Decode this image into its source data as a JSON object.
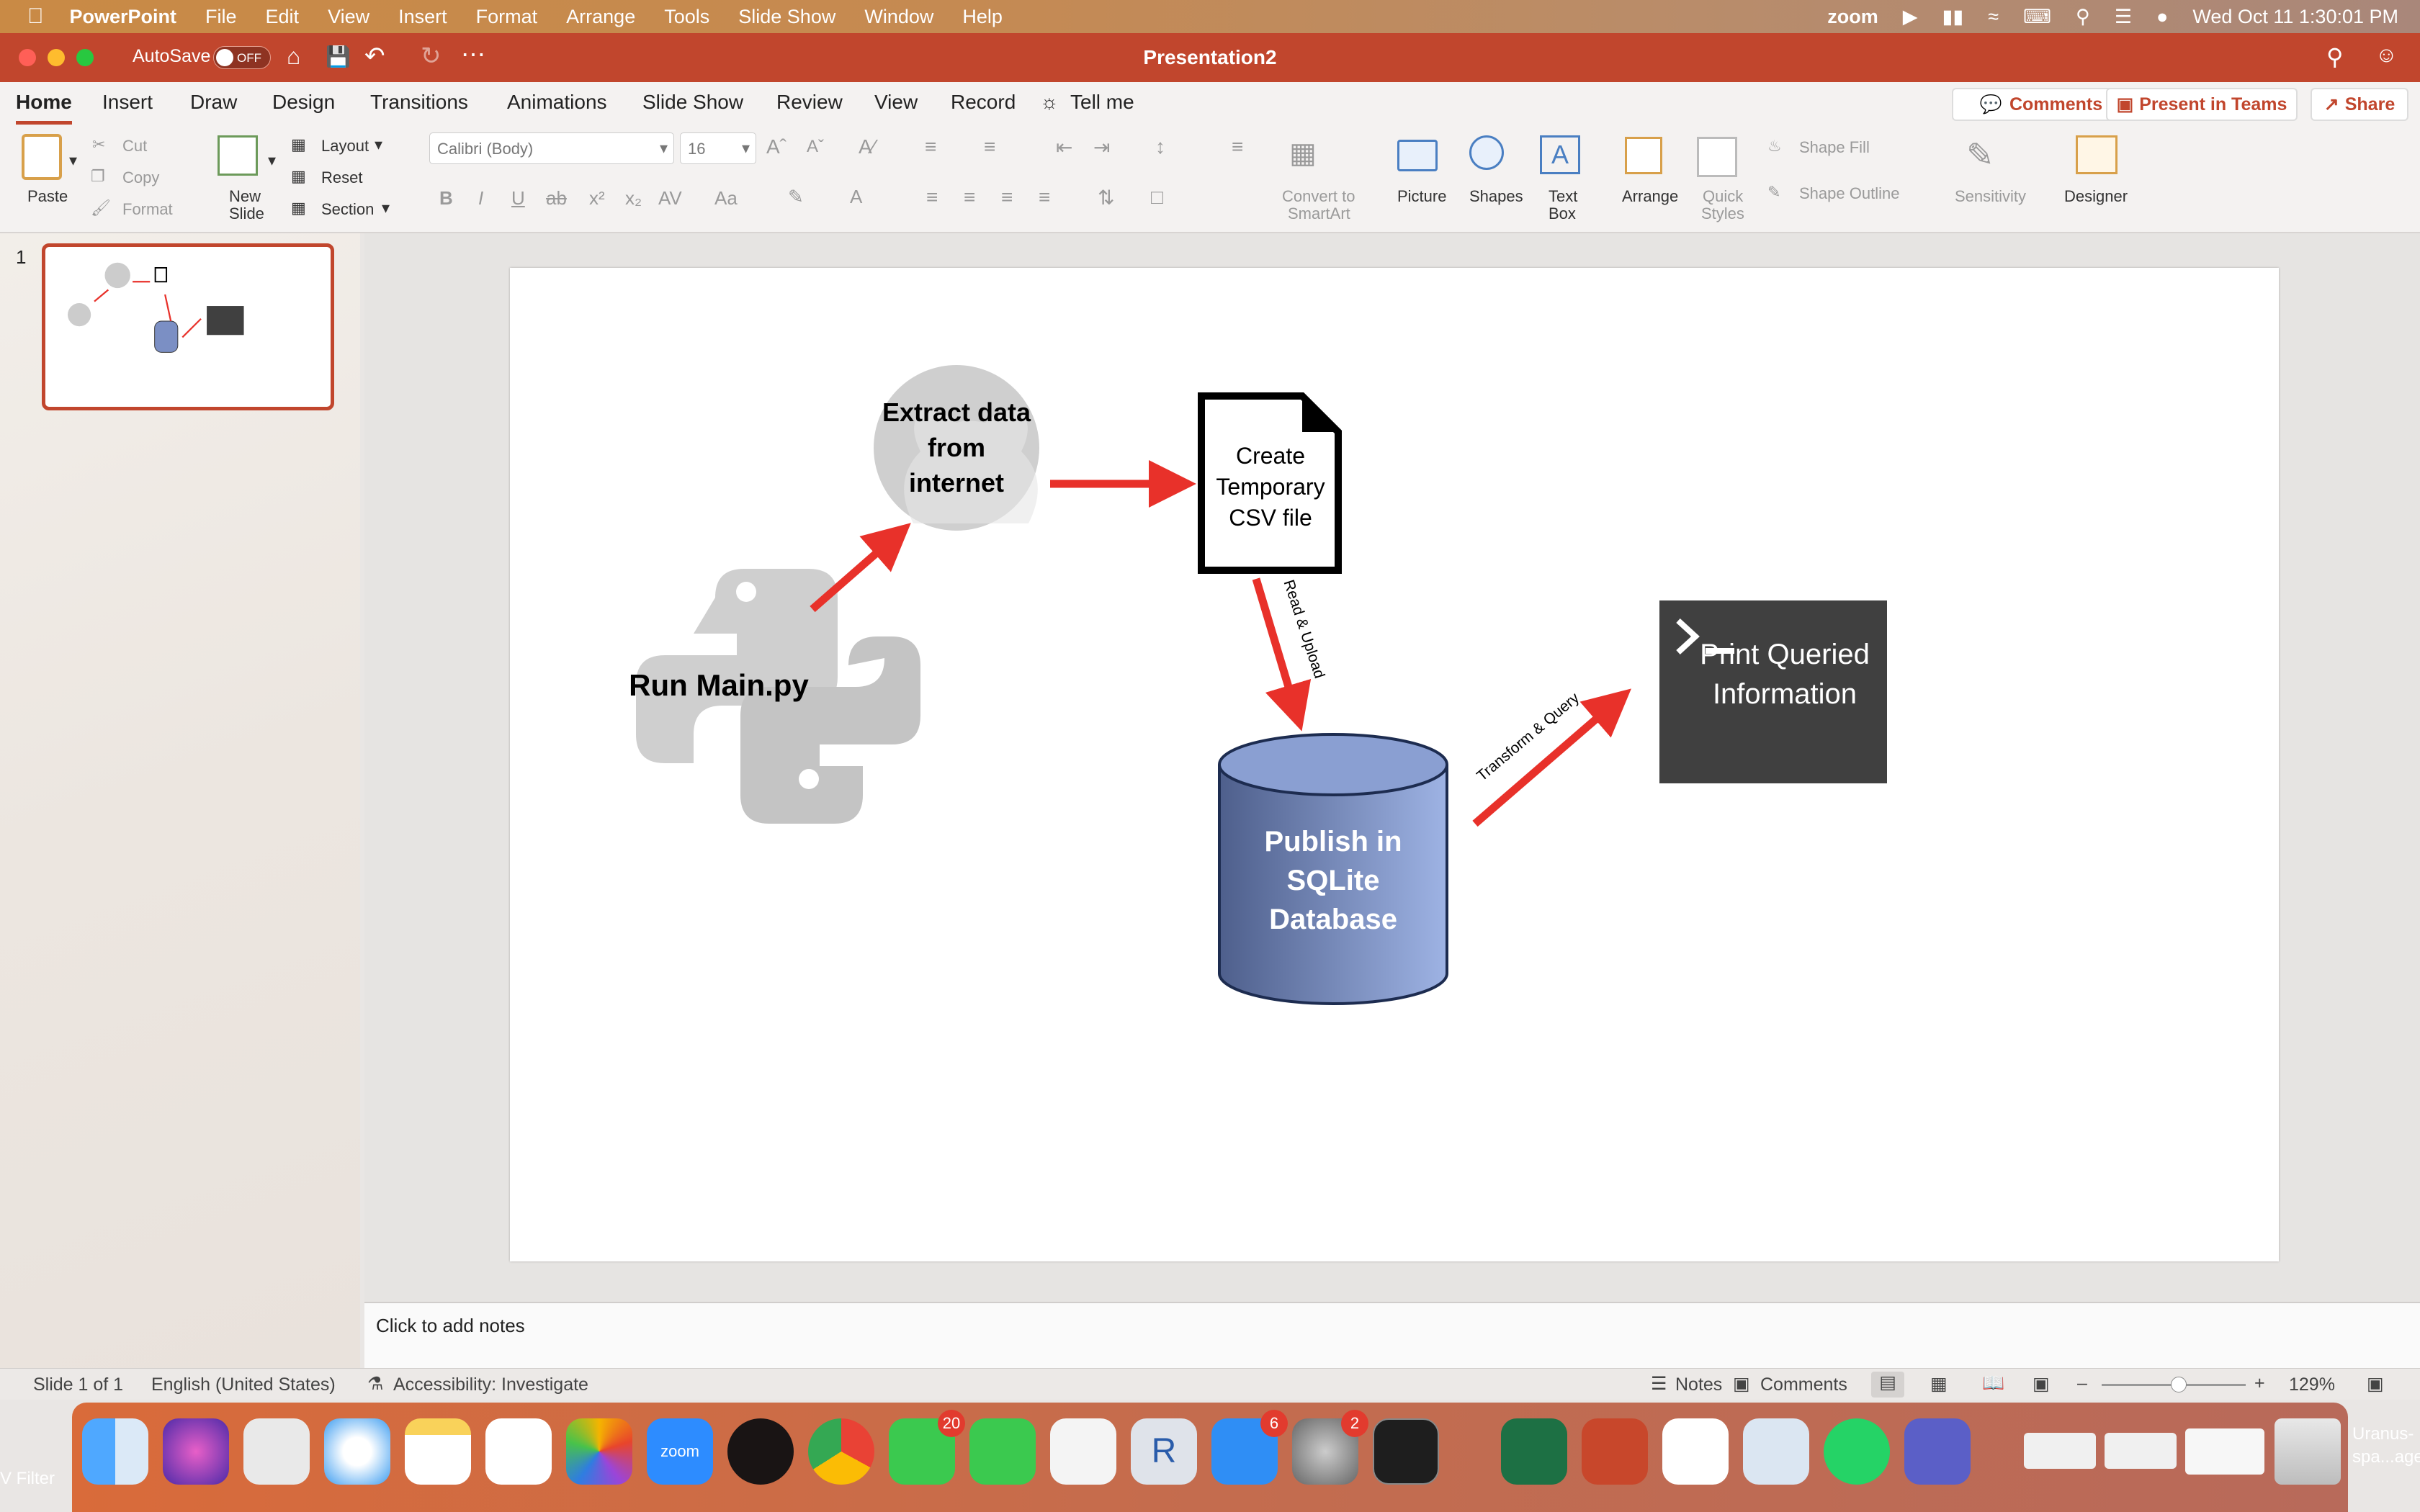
{
  "menubar": {
    "apple_icon": "apple-icon",
    "app_name": "PowerPoint",
    "items": [
      "File",
      "Edit",
      "View",
      "Insert",
      "Format",
      "Arrange",
      "Tools",
      "Slide Show",
      "Window",
      "Help"
    ],
    "zoom_label": "zoom",
    "datetime": "Wed Oct 11  1:30:01 PM"
  },
  "titlebar": {
    "autosave_label": "AutoSave",
    "autosave_state": "OFF",
    "title": "Presentation2"
  },
  "ribbon": {
    "tabs": [
      "Home",
      "Insert",
      "Draw",
      "Design",
      "Transitions",
      "Animations",
      "Slide Show",
      "Review",
      "View",
      "Record"
    ],
    "tell_me": "Tell me",
    "comments_btn": "Comments",
    "present_btn": "Present in Teams",
    "share_btn": "Share",
    "paste": "Paste",
    "cut": "Cut",
    "copy": "Copy",
    "format": "Format",
    "new_slide_1": "New",
    "new_slide_2": "Slide",
    "layout": "Layout",
    "reset": "Reset",
    "section": "Section",
    "font_name": "Calibri (Body)",
    "font_size": "16",
    "convert_1": "Convert to",
    "convert_2": "SmartArt",
    "picture": "Picture",
    "shapes": "Shapes",
    "textbox_1": "Text",
    "textbox_2": "Box",
    "arrange": "Arrange",
    "quick_1": "Quick",
    "quick_2": "Styles",
    "shape_fill": "Shape Fill",
    "shape_outline": "Shape Outline",
    "sensitivity": "Sensitivity",
    "designer": "Designer"
  },
  "thumbnail": {
    "number": "1"
  },
  "slide": {
    "run_main": "Run Main.py",
    "extract": "Extract data from internet",
    "create_csv": "Create Temporary CSV file",
    "read_upload": "Read & Upload",
    "publish": "Publish in SQLite Database",
    "transform_query": "Transform & Query",
    "print_info": "Print Queried Information",
    "arrow_color": "#e8312a",
    "db_color": "#7b8fc4",
    "terminal_color": "#404040"
  },
  "notes": {
    "placeholder": "Click to add notes"
  },
  "status": {
    "slide_info": "Slide 1 of 1",
    "language": "English (United States)",
    "accessibility": "Accessibility: Investigate",
    "notes": "Notes",
    "comments": "Comments",
    "zoom": "129%"
  },
  "dock": {
    "facetime_badge": "20",
    "appstore_badge": "6",
    "settings_badge": "2",
    "right_label_1": "Uranus-",
    "right_label_2": "spa...age",
    "left_partial": "V Filter"
  }
}
